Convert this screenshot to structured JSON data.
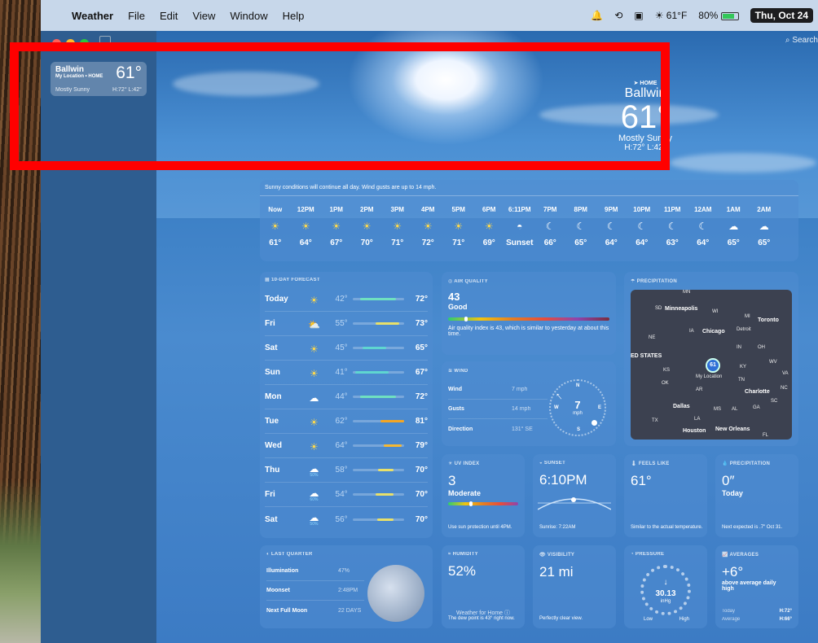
{
  "menubar": {
    "app": "Weather",
    "items": [
      "File",
      "Edit",
      "View",
      "Window",
      "Help"
    ],
    "weather": "61°F",
    "battery": "80%",
    "date": "Thu, Oct 24"
  },
  "sidebar": {
    "location_name": "Ballwin",
    "location_sub": "My Location • HOME",
    "temp": "61°",
    "condition": "Mostly Sunny",
    "hilo": "H:72° L:42°"
  },
  "search": {
    "label": "Search"
  },
  "hero": {
    "home_label": "HOME",
    "city": "Ballwin",
    "temp": "61°",
    "condition": "Mostly Sunny",
    "hilo": "H:72° L:42°"
  },
  "hourly": {
    "message": "Sunny conditions will continue all day. Wind gusts are up to 14 mph.",
    "hours": [
      {
        "time": "Now",
        "icon": "sun",
        "temp": "61°"
      },
      {
        "time": "12PM",
        "icon": "sun",
        "temp": "64°"
      },
      {
        "time": "1PM",
        "icon": "sun",
        "temp": "67°"
      },
      {
        "time": "2PM",
        "icon": "sun",
        "temp": "70°"
      },
      {
        "time": "3PM",
        "icon": "sun",
        "temp": "71°"
      },
      {
        "time": "4PM",
        "icon": "sun",
        "temp": "72°"
      },
      {
        "time": "5PM",
        "icon": "sun",
        "temp": "71°"
      },
      {
        "time": "6PM",
        "icon": "sun",
        "temp": "69°"
      },
      {
        "time": "6:11PM",
        "icon": "sunset",
        "temp": "Sunset"
      },
      {
        "time": "7PM",
        "icon": "moon",
        "temp": "66°"
      },
      {
        "time": "8PM",
        "icon": "moon",
        "temp": "65°"
      },
      {
        "time": "9PM",
        "icon": "moon",
        "temp": "64°"
      },
      {
        "time": "10PM",
        "icon": "moon",
        "temp": "64°"
      },
      {
        "time": "11PM",
        "icon": "moon",
        "temp": "63°"
      },
      {
        "time": "12AM",
        "icon": "moon",
        "temp": "64°"
      },
      {
        "time": "1AM",
        "icon": "cloud-moon",
        "temp": "65°"
      },
      {
        "time": "2AM",
        "icon": "cloud-moon",
        "temp": "65°"
      }
    ]
  },
  "ten_day": {
    "title": "10-DAY FORECAST",
    "days": [
      {
        "day": "Today",
        "icon": "sun",
        "pct": "",
        "lo": "42°",
        "hi": "72°",
        "bar_from": 0.15,
        "bar_to": 0.85,
        "color": "#6fe0c0"
      },
      {
        "day": "Fri",
        "icon": "partly-cloudy",
        "pct": "",
        "lo": "55°",
        "hi": "73°",
        "bar_from": 0.45,
        "bar_to": 0.9,
        "color": "#e8e06a"
      },
      {
        "day": "Sat",
        "icon": "sun",
        "pct": "",
        "lo": "45°",
        "hi": "65°",
        "bar_from": 0.2,
        "bar_to": 0.65,
        "color": "#5fd6d0"
      },
      {
        "day": "Sun",
        "icon": "sun",
        "pct": "",
        "lo": "41°",
        "hi": "67°",
        "bar_from": 0.05,
        "bar_to": 0.7,
        "color": "#5fd6d0"
      },
      {
        "day": "Mon",
        "icon": "cloud",
        "pct": "",
        "lo": "44°",
        "hi": "72°",
        "bar_from": 0.15,
        "bar_to": 0.85,
        "color": "#6fe0c0"
      },
      {
        "day": "Tue",
        "icon": "sun",
        "pct": "",
        "lo": "62°",
        "hi": "81°",
        "bar_from": 0.55,
        "bar_to": 1.0,
        "color": "#f5a623"
      },
      {
        "day": "Wed",
        "icon": "sun",
        "pct": "",
        "lo": "64°",
        "hi": "79°",
        "bar_from": 0.6,
        "bar_to": 0.95,
        "color": "#f5b833"
      },
      {
        "day": "Thu",
        "icon": "cloud",
        "pct": "50%",
        "lo": "58°",
        "hi": "70°",
        "bar_from": 0.5,
        "bar_to": 0.8,
        "color": "#e8e06a"
      },
      {
        "day": "Fri",
        "icon": "cloud",
        "pct": "60%",
        "lo": "54°",
        "hi": "70°",
        "bar_from": 0.45,
        "bar_to": 0.8,
        "color": "#e8e06a"
      },
      {
        "day": "Sat",
        "icon": "cloud",
        "pct": "50%",
        "lo": "56°",
        "hi": "70°",
        "bar_from": 0.48,
        "bar_to": 0.8,
        "color": "#e8e06a"
      }
    ]
  },
  "air_quality": {
    "title": "AIR QUALITY",
    "value": "43",
    "label": "Good",
    "level": 0.1,
    "text": "Air quality index is 43, which is similar to yesterday at about this time."
  },
  "wind": {
    "title": "WIND",
    "rows": [
      {
        "k": "Wind",
        "v": "7 mph"
      },
      {
        "k": "Gusts",
        "v": "14 mph"
      },
      {
        "k": "Direction",
        "v": "131° SE"
      }
    ],
    "speed": "7",
    "unit": "mph",
    "dirs": [
      "N",
      "E",
      "S",
      "W"
    ]
  },
  "precipitation_map": {
    "title": "PRECIPITATION",
    "labels": [
      "Minneapolis",
      "Toronto",
      "Chicago",
      "Detroit",
      "ED STATES",
      "My Location",
      "Charlotte",
      "Dallas",
      "Houston",
      "New Orleans",
      "MI",
      "IA",
      "IN",
      "OH",
      "WV",
      "VA",
      "NC",
      "SC",
      "TN",
      "KY",
      "OK",
      "AR",
      "MS",
      "AL",
      "GA",
      "TX",
      "LA",
      "NE",
      "SD",
      "WI",
      "FL",
      "MN",
      "KS"
    ],
    "pin_temp": "61"
  },
  "uv": {
    "title": "UV INDEX",
    "value": "3",
    "label": "Moderate",
    "level": 0.3,
    "foot": "Use sun protection until 4PM."
  },
  "sunset": {
    "title": "SUNSET",
    "value": "6:10PM",
    "foot": "Sunrise: 7:22AM"
  },
  "feels_like": {
    "title": "FEELS LIKE",
    "value": "61°",
    "foot": "Similar to the actual temperature."
  },
  "precipitation": {
    "title": "PRECIPITATION",
    "value": "0″",
    "sub": "Today",
    "foot": "Next expected is .7″ Oct 31."
  },
  "moon": {
    "title": "LAST QUARTER",
    "rows": [
      {
        "k": "Illumination",
        "v": "47%"
      },
      {
        "k": "Moonset",
        "v": "2:48PM"
      },
      {
        "k": "Next Full Moon",
        "v": "22 DAYS"
      }
    ]
  },
  "humidity": {
    "title": "HUMIDITY",
    "value": "52%",
    "foot": "The dew point is 43° right now."
  },
  "visibility": {
    "title": "VISIBILITY",
    "value": "21 mi",
    "foot": "Perfectly clear view."
  },
  "pressure": {
    "title": "PRESSURE",
    "value": "30.13",
    "unit": "inHg",
    "low": "Low",
    "high": "High"
  },
  "averages": {
    "title": "AVERAGES",
    "value": "+6°",
    "sub": "above average daily high",
    "today_label": "Today",
    "today_val": "H:72°",
    "avg_label": "Average",
    "avg_val": "H:66°"
  },
  "footer": {
    "text": "Weather for Home ⓘ"
  },
  "colors": {
    "sun": "#ffd94a",
    "highlight": "#ff0000"
  }
}
